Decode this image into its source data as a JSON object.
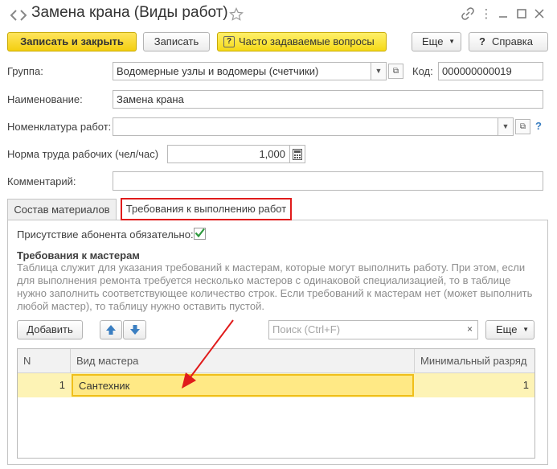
{
  "window": {
    "title": "Замена крана (Виды работ)",
    "icons": [
      "star-icon",
      "link-icon",
      "more-icon",
      "minimize-icon",
      "maximize-icon",
      "close-icon"
    ]
  },
  "toolbar": {
    "save_close_label": "Записать и закрыть",
    "save_label": "Записать",
    "faq_label": "Часто задаваемые вопросы",
    "more_label": "Еще",
    "help_label": "Справка",
    "help_glyph": "?"
  },
  "form": {
    "group_label": "Группа:",
    "group_value": "Водомерные узлы и водомеры (счетчики)",
    "code_label": "Код:",
    "code_value": "000000000019",
    "name_label": "Наименование:",
    "name_value": "Замена крана",
    "nomenclature_label": "Номенклатура работ:",
    "nomenclature_value": "",
    "labor_label": "Норма труда рабочих (чел/час)",
    "labor_value": "1,000",
    "comment_label": "Комментарий:",
    "comment_value": ""
  },
  "tabs": [
    {
      "label": "Состав материалов"
    },
    {
      "label": "Требования к выполнению работ"
    }
  ],
  "panel": {
    "subscriber_label": "Присутствие абонента обязательно:",
    "subscriber_checked": true,
    "masters_title": "Требования к мастерам",
    "masters_desc_lines": [
      "Таблица служит для указания требований к мастерам, которые могут выполнить работу. При этом, если",
      "для выполнения ремонта требуется несколько мастеров с одинаковой специализацией, то в таблице",
      "нужно заполнить соответствующее количество строк. Если требований к мастерам нет (может выполнить",
      "любой мастер), то таблицу нужно оставить пустой."
    ],
    "add_label": "Добавить",
    "search_placeholder": "Поиск (Ctrl+F)",
    "more_label": "Еще"
  },
  "table": {
    "columns": [
      "N",
      "Вид мастера",
      "Минимальный разряд"
    ],
    "rows": [
      {
        "n": "1",
        "master": "Сантехник",
        "rank": "1"
      }
    ]
  },
  "colors": {
    "accent_yellow": "#f3cf10",
    "selected_row": "#fdf3b5",
    "highlight_red": "#e01b1b",
    "check_green": "#2e9a3e",
    "link_blue": "#3a7ec1"
  }
}
